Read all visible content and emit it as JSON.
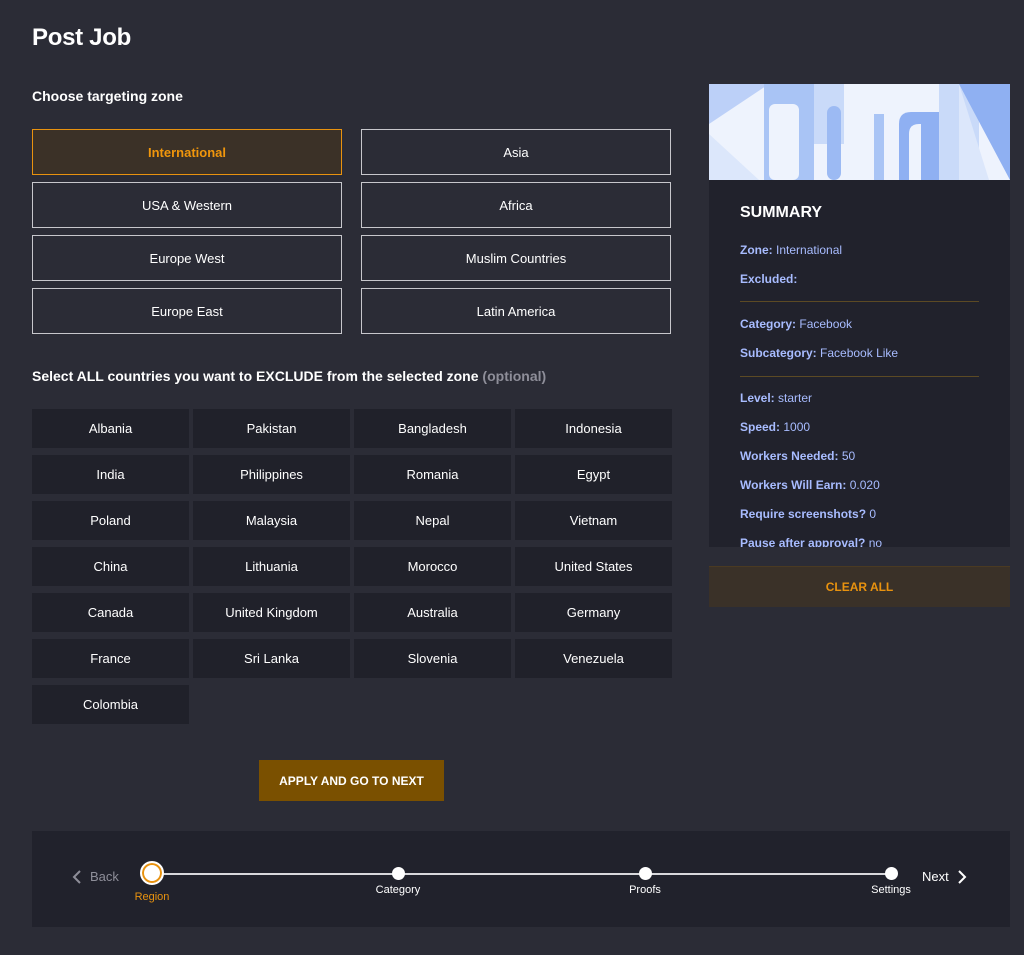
{
  "page": {
    "title": "Post Job"
  },
  "zones": {
    "heading": "Choose targeting zone",
    "items": [
      {
        "label": "International",
        "selected": true
      },
      {
        "label": "Asia",
        "selected": false
      },
      {
        "label": "USA & Western",
        "selected": false
      },
      {
        "label": "Africa",
        "selected": false
      },
      {
        "label": "Europe West",
        "selected": false
      },
      {
        "label": "Muslim Countries",
        "selected": false
      },
      {
        "label": "Europe East",
        "selected": false
      },
      {
        "label": "Latin America",
        "selected": false
      }
    ]
  },
  "exclude": {
    "heading": "Select ALL countries you want to EXCLUDE from the selected zone",
    "optional": "(optional)",
    "countries": [
      "Albania",
      "Pakistan",
      "Bangladesh",
      "Indonesia",
      "India",
      "Philippines",
      "Romania",
      "Egypt",
      "Poland",
      "Malaysia",
      "Nepal",
      "Vietnam",
      "China",
      "Lithuania",
      "Morocco",
      "United States",
      "Canada",
      "United Kingdom",
      "Australia",
      "Germany",
      "France",
      "Sri Lanka",
      "Slovenia",
      "Venezuela",
      "Colombia"
    ]
  },
  "apply_button": "APPLY AND GO TO NEXT",
  "summary": {
    "title": "SUMMARY",
    "zone_key": "Zone:",
    "zone_val": "International",
    "excluded_key": "Excluded:",
    "excluded_val": "",
    "category_key": "Category:",
    "category_val": "Facebook",
    "subcategory_key": "Subcategory:",
    "subcategory_val": "Facebook Like",
    "level_key": "Level:",
    "level_val": "starter",
    "speed_key": "Speed:",
    "speed_val": "1000",
    "workers_needed_key": "Workers Needed:",
    "workers_needed_val": "50",
    "workers_earn_key": "Workers Will Earn:",
    "workers_earn_val": "0.020",
    "screenshots_key": "Require screenshots?",
    "screenshots_val": "0",
    "pause_key": "Pause after approval?",
    "pause_val": "no",
    "clear_all": "CLEAR ALL"
  },
  "stepper": {
    "back": "Back",
    "next": "Next",
    "steps": [
      {
        "label": "Region",
        "active": true
      },
      {
        "label": "Category",
        "active": false
      },
      {
        "label": "Proofs",
        "active": false
      },
      {
        "label": "Settings",
        "active": false
      }
    ]
  },
  "colors": {
    "accent": "#e8920f",
    "background": "#2b2c36",
    "panel": "#21222c",
    "summary_key": "#a8bcff"
  }
}
